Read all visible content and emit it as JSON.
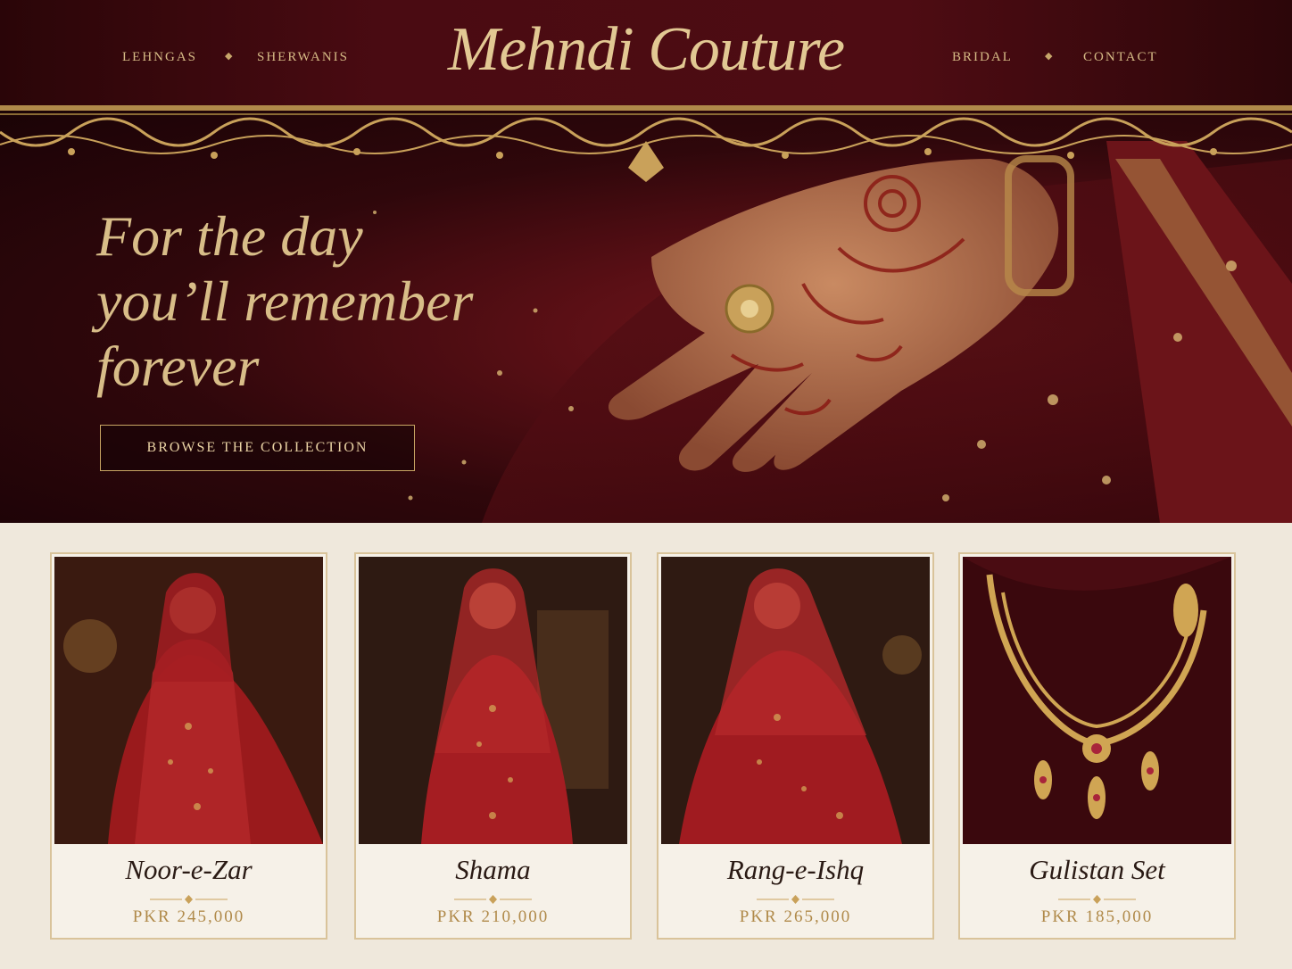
{
  "brand": {
    "name": "Mehndi Couture"
  },
  "nav": {
    "left": [
      {
        "label": "Lehngas"
      },
      {
        "label": "Sherwanis"
      }
    ],
    "right": [
      {
        "label": "Bridal"
      },
      {
        "label": "Contact"
      }
    ],
    "separator": "◆"
  },
  "hero": {
    "title_lines": [
      "For the day",
      "you’ll remember",
      "forever"
    ],
    "cta_label": "Browse the Collection"
  },
  "products": [
    {
      "name": "Noor-e-Zar",
      "price": "PKR 245,000"
    },
    {
      "name": "Shama",
      "price": "PKR 210,000"
    },
    {
      "name": "Rang-e-Ishq",
      "price": "PKR 265,000"
    },
    {
      "name": "Gulistan Set",
      "price": "PKR 185,000"
    }
  ],
  "colors": {
    "header_bg": "#4a0b12",
    "gold": "#d6bb86",
    "velvet_red": "#7a1a1f",
    "cream": "#efe8dc",
    "price_gold": "#b08a4a"
  },
  "icons": [
    "diamond-separator-icon",
    "ornamental-border",
    "card-divider-icon"
  ]
}
